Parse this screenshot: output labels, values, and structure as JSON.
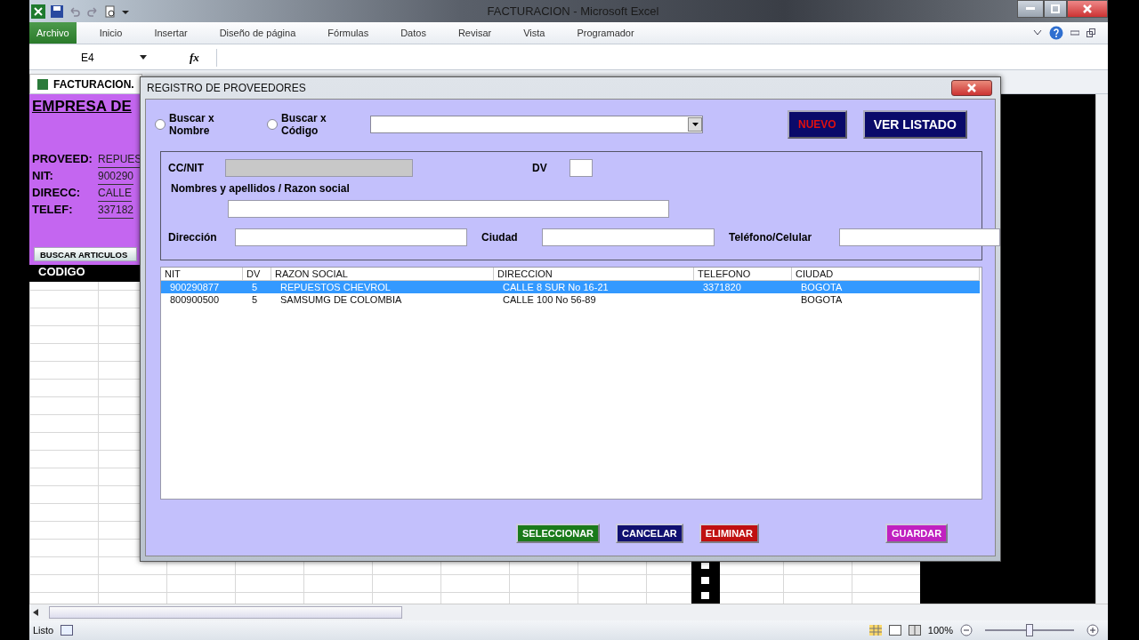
{
  "window": {
    "title": "FACTURACION - Microsoft Excel"
  },
  "ribbon_tabs": [
    {
      "label": "Archivo",
      "selected": true
    },
    {
      "label": "Inicio",
      "selected": false
    },
    {
      "label": "Insertar",
      "selected": false
    },
    {
      "label": "Diseño de página",
      "selected": false
    },
    {
      "label": "Fórmulas",
      "selected": false
    },
    {
      "label": "Datos",
      "selected": false
    },
    {
      "label": "Revisar",
      "selected": false
    },
    {
      "label": "Vista",
      "selected": false
    },
    {
      "label": "Programador",
      "selected": false
    }
  ],
  "formula_bar": {
    "name_box": "E4",
    "fx": "fx"
  },
  "workbook_tabs": [
    {
      "label": "FACTURACION.",
      "selected": true
    }
  ],
  "sheet": {
    "company": "EMPRESA DE",
    "fields": [
      {
        "label": "PROVEED:",
        "value": "REPUES"
      },
      {
        "label": "NIT:",
        "value": "900290"
      },
      {
        "label": "DIRECC:",
        "value": "CALLE"
      },
      {
        "label": "TELEF:",
        "value": "337182"
      }
    ],
    "search_button": "BUSCAR ARTICULOS",
    "code_header": "CODIGO"
  },
  "dialog": {
    "title": "REGISTRO DE PROVEEDORES",
    "search_options": [
      {
        "label": "Buscar x\nNombre",
        "checked": false
      },
      {
        "label": "Buscar x\nCódigo",
        "checked": false
      }
    ],
    "top_buttons": [
      {
        "label": "NUEVO",
        "kind": "new"
      },
      {
        "label": "VER LISTADO",
        "kind": "list"
      }
    ],
    "form": {
      "id_label": "CC/NIT",
      "dv_label": "DV",
      "name_label": "Nombres y apellidos / Razon social",
      "address_label": "Dirección",
      "city_label": "Ciudad",
      "phone_label": "Teléfono/Celular"
    },
    "table": {
      "columns": [
        "NIT",
        "DV",
        "RAZON SOCIAL",
        "DIRECCION",
        "TELEFONO",
        "CIUDAD"
      ],
      "rows": [
        {
          "cells": [
            "900290877",
            "5",
            "REPUESTOS CHEVROL",
            "CALLE 8 SUR No 16-21",
            "3371820",
            "BOGOTA"
          ],
          "selected": true
        },
        {
          "cells": [
            "800900500",
            "5",
            "SAMSUMG DE COLOMBIA",
            "CALLE 100 No 56-89",
            "",
            "BOGOTA"
          ],
          "selected": false
        }
      ]
    },
    "bottom_buttons": [
      {
        "label": "SELECCIONAR",
        "color": "#1a7a1a"
      },
      {
        "label": "CANCELAR",
        "color": "#101070"
      },
      {
        "label": "ELIMINAR",
        "color": "#c01010"
      },
      {
        "label": "GUARDAR",
        "color": "#c020c0"
      }
    ]
  },
  "status_bar": {
    "text": "Listo",
    "zoom": "100%",
    "zoom_slider": {
      "level": 0.5
    }
  }
}
